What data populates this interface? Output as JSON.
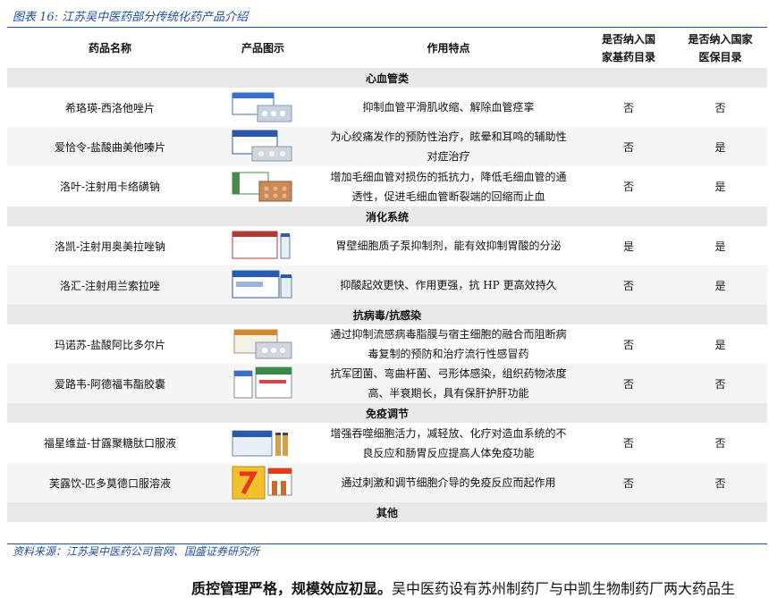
{
  "caption": "图表 16:  江苏吴中医药部分传统化药产品介绍",
  "headers": {
    "name": "药品名称",
    "image": "产品图示",
    "feature": "作用特点",
    "essential_line1": "是否纳入国",
    "essential_line2": "家基药目录",
    "insurance_line1": "是否纳入国家",
    "insurance_line2": "医保目录"
  },
  "categories": [
    "心血管类",
    "消化系统",
    "抗病毒/抗感染",
    "免疫调节",
    "其他"
  ],
  "rows": [
    {
      "name": "希珞瑛-西洛他唑片",
      "feature": "抑制血管平滑肌收缩、解除血管痉挛",
      "essential": "否",
      "insurance": "否"
    },
    {
      "name": "爱恰令-盐酸曲美他嗪片",
      "feature_1": "为心绞痛发作的预防性治疗，眩晕和耳鸣的辅助性",
      "feature_2": "对症治疗",
      "essential": "否",
      "insurance": "是"
    },
    {
      "name": "洛叶-注射用卡络磺钠",
      "feature_1": "增加毛细血管对损伤的抵抗力，降低毛细血管的通",
      "feature_2": "透性，促进毛细血管断裂端的回缩而止血",
      "essential": "否",
      "insurance": "是"
    },
    {
      "name": "洛凯-注射用奥美拉唑钠",
      "feature": "胃壁细胞质子泵抑制剂，能有效抑制胃酸的分泌",
      "essential": "是",
      "insurance": "是"
    },
    {
      "name": "洛汇-注射用兰索拉唑",
      "feature": "抑酸起效更快、作用更强，抗 HP 更高效持久",
      "essential": "否",
      "insurance": "是"
    },
    {
      "name": "玛诺苏-盐酸阿比多尔片",
      "feature_1": "通过抑制流感病毒脂膜与宿主细胞的融合而阻断病",
      "feature_2": "毒复制的预防和治疗流行性感冒药",
      "essential": "否",
      "insurance": "是"
    },
    {
      "name": "爱路韦-阿德福韦酯胶囊",
      "feature_1": "抗军团菌、弯曲杆菌、弓形体感染，组织药物浓度",
      "feature_2": "高、半衰期长，具有保肝护肝功能",
      "essential": "否",
      "insurance": "否"
    },
    {
      "name": "福星维益-甘露聚糖肽口服液",
      "feature_1": "增强吞噬细胞活力，减轻放、化疗对造血系统的不",
      "feature_2": "良反应和肠胃反应提高人体免疫功能",
      "essential": "否",
      "insurance": "否"
    },
    {
      "name": "芙露饮-匹多莫德口服溶液",
      "feature": "通过刺激和调节细胞介导的免疫反应而起作用",
      "essential": "否",
      "insurance": "否"
    }
  ],
  "source": "资料来源：江苏吴中医药公司官网、国盛证券研究所",
  "cutoff_text_bold": "质控管理严格，规模效应初显。",
  "cutoff_text": "吴中医药设有苏州制药厂与中凯生物制药厂两大药品生",
  "colors": {
    "accent": "#1f4e9c",
    "category_bg": "#e8e8e8",
    "alt_row_bg": "#f5f5f5"
  }
}
